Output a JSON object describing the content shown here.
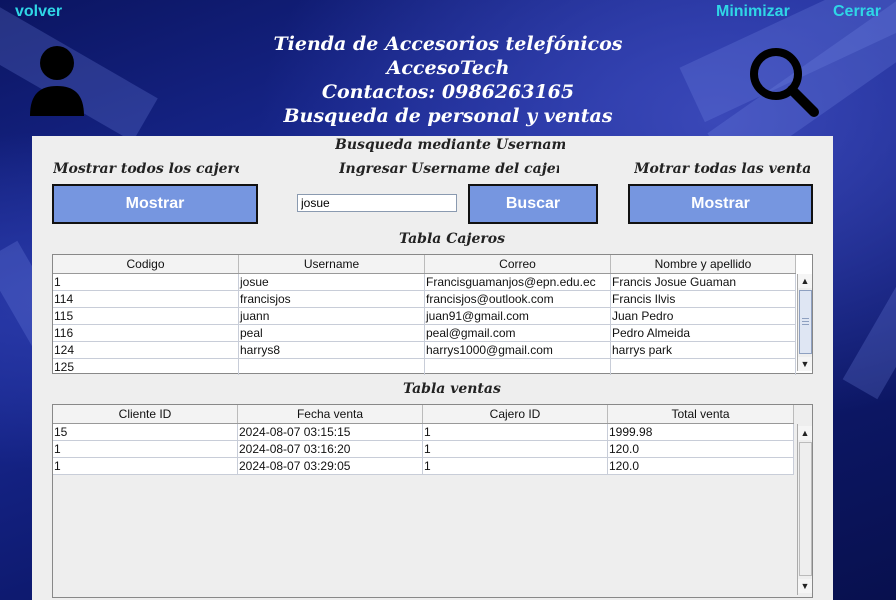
{
  "top": {
    "back": "volver",
    "minimize": "Minimizar",
    "close": "Cerrar"
  },
  "header": {
    "line1": "Tienda de Accesorios telefónicos",
    "line2": "AccesoTech",
    "line3": "Contactos: 0986263165",
    "line4": "Busqueda de personal y ventas"
  },
  "panel": {
    "search_title": "Busqueda mediante Username",
    "label_all_cashiers": "Mostrar todos los cajeros",
    "label_enter_username": "Ingresar Username del cajero",
    "label_all_sales": "Motrar todas las ventas",
    "btn_show_cashiers": "Mostrar",
    "btn_search": "Buscar",
    "btn_show_sales": "Mostrar",
    "username_value": "josue",
    "cashiers_title": "Tabla Cajeros",
    "sales_title": "Tabla ventas"
  },
  "cashiers": {
    "headers": [
      "Codigo",
      "Username",
      "Correo",
      "Nombre y apellido"
    ],
    "rows": [
      [
        "1",
        "josue",
        "Francisguamanjos@epn.edu.ec",
        "Francis Josue Guaman"
      ],
      [
        "114",
        "francisjos",
        "francisjos@outlook.com",
        "Francis Ilvis"
      ],
      [
        "115",
        "juann",
        "juan91@gmail.com",
        "Juan Pedro"
      ],
      [
        "116",
        "peal",
        "peal@gmail.com",
        "Pedro Almeida"
      ],
      [
        "124",
        "harrys8",
        "harrys1000@gmail.com",
        "harrys park"
      ],
      [
        "125",
        "",
        "",
        ""
      ]
    ]
  },
  "sales": {
    "headers": [
      "Cliente ID",
      "Fecha venta",
      "Cajero ID",
      "Total venta"
    ],
    "rows": [
      [
        "15",
        "2024-08-07 03:15:15",
        "1",
        "1999.98"
      ],
      [
        "1",
        "2024-08-07 03:16:20",
        "1",
        "120.0"
      ],
      [
        "1",
        "2024-08-07 03:29:05",
        "1",
        "120.0"
      ]
    ]
  }
}
